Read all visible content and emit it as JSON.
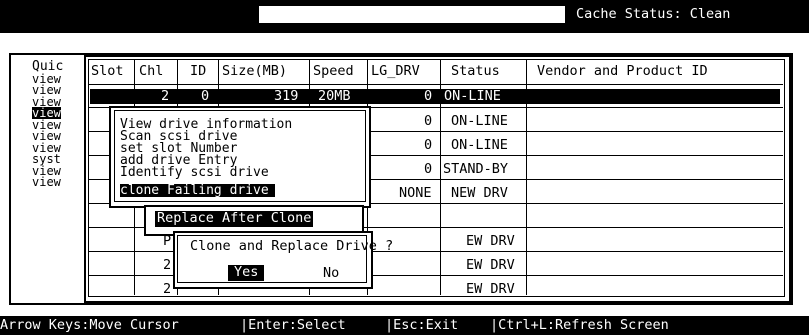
{
  "header": {
    "cache_status": "Cache Status: Clean"
  },
  "quick_menu": {
    "label": "Quic",
    "items": [
      "view",
      "view",
      "view",
      "view",
      "view",
      "view",
      "view",
      "syst",
      "view",
      "view"
    ],
    "selected_index": 3
  },
  "table": {
    "columns": [
      "Slot",
      "Chl",
      "ID",
      "Size(MB)",
      "Speed",
      "LG_DRV",
      "Status",
      "Vendor and Product ID"
    ],
    "selected_row": {
      "slot": "",
      "chl": "2",
      "id": "0",
      "size": "319",
      "speed": "20MB",
      "lg_drv": "0",
      "status": "ON-LINE"
    },
    "rows": [
      {
        "lg_drv": "0",
        "status": "ON-LINE"
      },
      {
        "lg_drv": "0",
        "status": "ON-LINE"
      },
      {
        "lg_drv": "0",
        "status": "STAND-BY"
      },
      {
        "lg_drv": "NONE",
        "status": "NEW DRV"
      },
      {
        "slot_partial": "P",
        "status_partial": "EW DRV"
      },
      {
        "chl": "2",
        "status_partial": "EW DRV"
      },
      {
        "chl": "2",
        "status_partial": "EW DRV"
      }
    ]
  },
  "drive_menu": {
    "items": [
      "View drive information",
      "Scan scsi drive",
      "set slot Number",
      "add drive Entry",
      "Identify scsi drive",
      "clone Failing drive"
    ],
    "selected_index": 5
  },
  "clone_submenu": {
    "item": "Replace After Clone"
  },
  "dialog": {
    "title": "Clone and Replace Drive ?",
    "yes": "Yes",
    "no": "No"
  },
  "footer": {
    "hints": [
      "Arrow Keys:Move Cursor",
      "|Enter:Select",
      "|Esc:Exit",
      "|Ctrl+L:Refresh Screen"
    ]
  }
}
